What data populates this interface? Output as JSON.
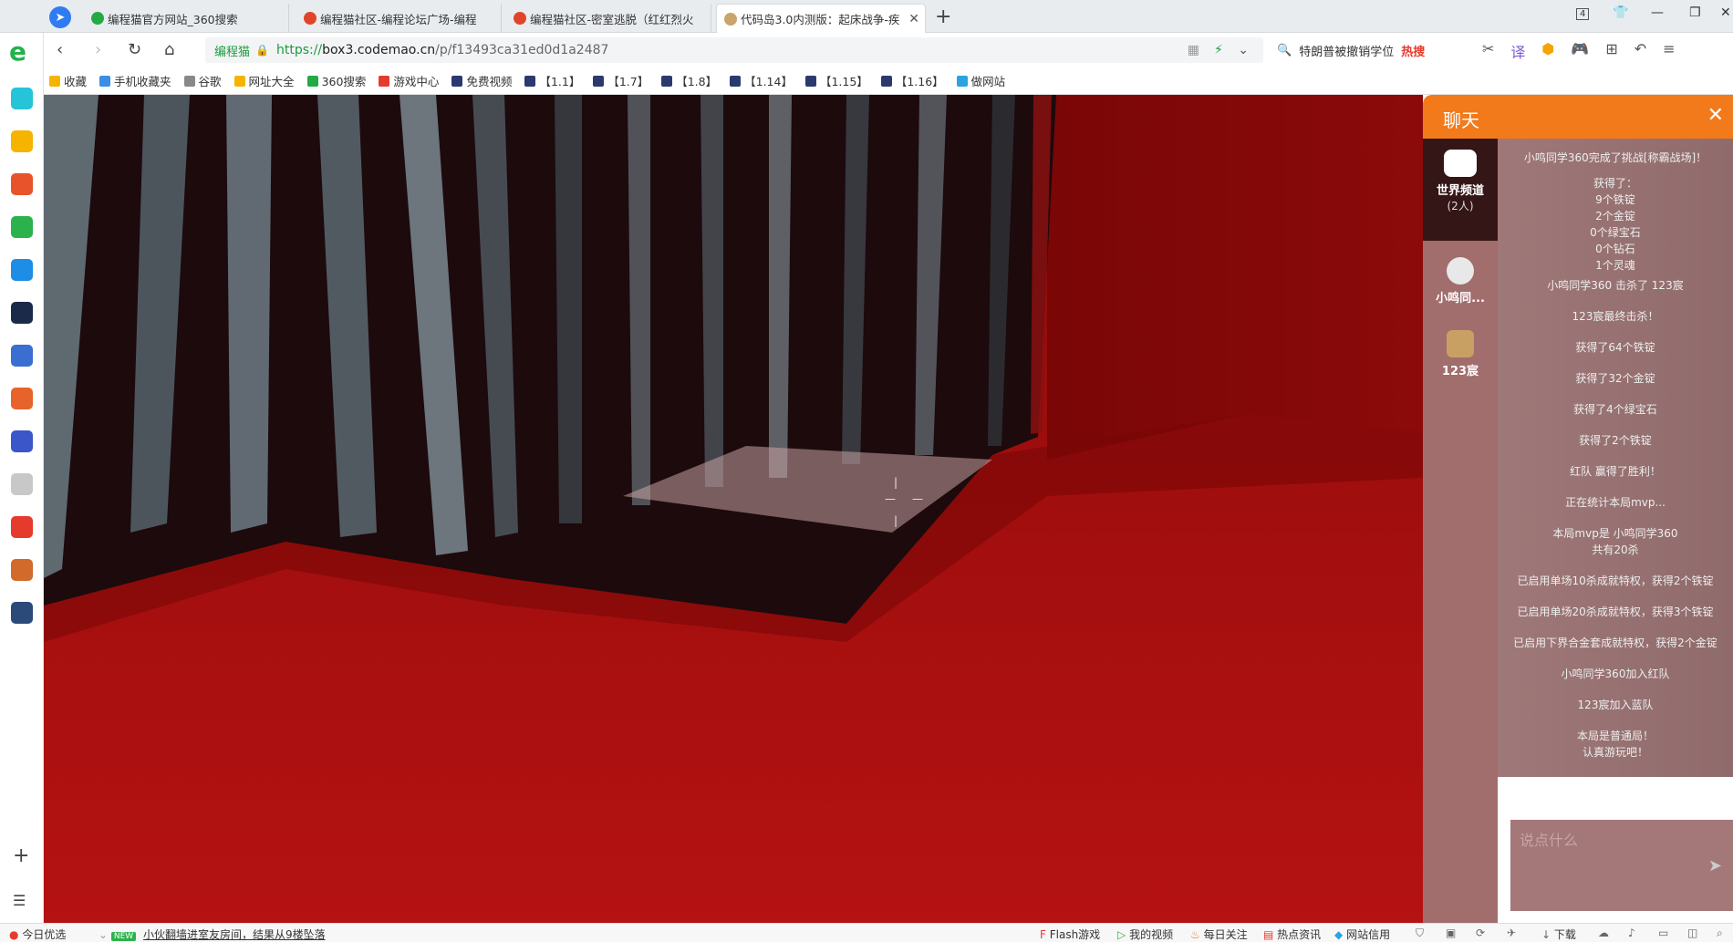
{
  "tabs": [
    {
      "title": "编程猫官方网站_360搜索",
      "icon_color": "#22aa44"
    },
    {
      "title": "编程猫社区-编程论坛广场-编程",
      "icon_color": "#e0452b"
    },
    {
      "title": "编程猫社区-密室逃脱（红红烈火",
      "icon_color": "#e0452b"
    },
    {
      "title": "代码岛3.0内测版：起床战争-疾",
      "icon_color": "#caa46a"
    }
  ],
  "window": {
    "tab_count": "4"
  },
  "address": {
    "site_tag": "编程猫",
    "url_https": "https://",
    "url_host": "box3.codemao.cn",
    "url_rest": "/p/f13493ca31ed0d1a2487"
  },
  "search": {
    "text": "特朗普被撤销学位",
    "hot_label": "热搜"
  },
  "bookmarks": [
    {
      "label": "收藏",
      "color": "#f5b400"
    },
    {
      "label": "手机收藏夹",
      "color": "#3a8ee6"
    },
    {
      "label": "谷歌",
      "color": "#888888"
    },
    {
      "label": "网址大全",
      "color": "#f5b400"
    },
    {
      "label": "360搜索",
      "color": "#22aa44"
    },
    {
      "label": "游戏中心",
      "color": "#e53b2c"
    },
    {
      "label": "免费视频",
      "color": "#2b3a6e"
    },
    {
      "label": "【1.1】",
      "color": "#2b3a6e"
    },
    {
      "label": "【1.7】",
      "color": "#2b3a6e"
    },
    {
      "label": "【1.8】",
      "color": "#2b3a6e"
    },
    {
      "label": "【1.14】",
      "color": "#2b3a6e"
    },
    {
      "label": "【1.15】",
      "color": "#2b3a6e"
    },
    {
      "label": "【1.16】",
      "color": "#2b3a6e"
    },
    {
      "label": "做网站",
      "color": "#2aa3e0"
    }
  ],
  "sidebar_icons": [
    {
      "name": "plus-health-icon",
      "color": "#25c4d9"
    },
    {
      "name": "star-icon",
      "color": "#f5b400"
    },
    {
      "name": "weibo-icon",
      "color": "#e8532b"
    },
    {
      "name": "mail-icon",
      "color": "#2bb24c"
    },
    {
      "name": "p-icon",
      "color": "#1e8de6"
    },
    {
      "name": "news-icon",
      "color": "#1c2a4a"
    },
    {
      "name": "doc-icon",
      "color": "#3a6fd1"
    },
    {
      "name": "novel-icon",
      "color": "#e8632b"
    },
    {
      "name": "game-icon",
      "color": "#3a56c9"
    },
    {
      "name": "panda-icon",
      "color": "#c8c8c8"
    },
    {
      "name": "redpacket-icon",
      "color": "#e53b2c"
    },
    {
      "name": "king-icon",
      "color": "#d26a2b"
    },
    {
      "name": "avatar-icon",
      "color": "#2b4a7a"
    }
  ],
  "chat": {
    "title": "聊天",
    "channels": [
      {
        "label": "世界频道",
        "count": "(2人)"
      },
      {
        "label": "小鸣同..."
      },
      {
        "label": "123宸"
      }
    ],
    "messages": [
      "小鸣同学360完成了挑战[称霸战场]！",
      "获得了：\n9个铁锭\n2个金锭\n0个绿宝石\n0个钻石\n1个灵魂",
      "小鸣同学360 击杀了 123宸",
      "123宸最终击杀！",
      "获得了64个铁锭",
      "获得了32个金锭",
      "获得了4个绿宝石",
      "获得了2个铁锭",
      "红队 赢得了胜利！",
      "正在统计本局mvp...",
      "本局mvp是 小鸣同学360\n共有20杀",
      "已启用单场10杀成就特权，获得2个铁锭",
      "已启用单场20杀成就特权，获得3个铁锭",
      "已启用下界合金套成就特权，获得2个金锭",
      "小鸣同学360加入红队",
      "123宸加入蓝队",
      "本局是普通局！\n认真游玩吧！"
    ],
    "input_placeholder": "说点什么"
  },
  "status": {
    "today_label": "今日优选",
    "news_badge": "NEW",
    "news_text": "小伙翻墙进室友房间，结果从9楼坠落",
    "flash_label": "Flash游戏",
    "video_label": "我的视频",
    "daily_label": "每日关注",
    "hot_label": "热点资讯",
    "credit_label": "网站信用",
    "download_label": "下载"
  }
}
